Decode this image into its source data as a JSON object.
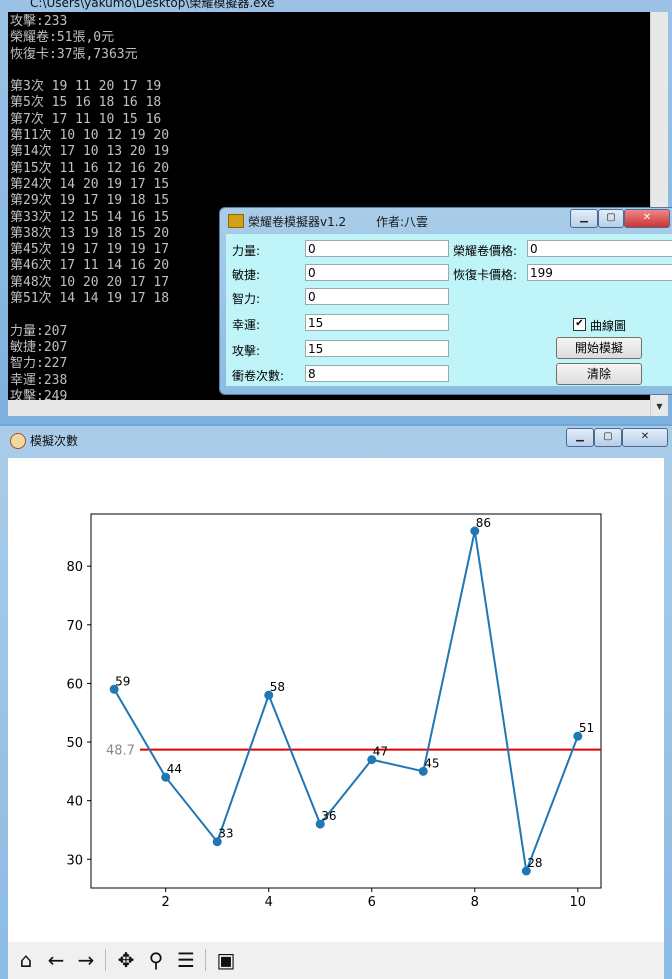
{
  "console": {
    "title": "C:\\Users\\yakumo\\Desktop\\榮耀模擬器.exe",
    "lines": [
      "攻擊:233",
      "榮耀卷:51張,0元",
      "恢復卡:37張,7363元",
      "",
      "第3次 19 11 20 17 19",
      "第5次 15 16 18 16 18",
      "第7次 17 11 10 15 16",
      "第11次 10 10 12 19 20",
      "第14次 17 10 13 20 19",
      "第15次 11 16 12 16 20",
      "第24次 14 20 19 17 15",
      "第29次 19 17 19 18 15",
      "第33次 12 15 14 16 15",
      "第38次 13 19 18 15 20",
      "第45次 19 17 19 19 17",
      "第46次 17 11 14 16 20",
      "第48次 10 20 20 17 17",
      "第51次 14 14 19 17 18",
      "",
      "力量:207",
      "敏捷:207",
      "智力:227",
      "幸運:238",
      "攻擊:249"
    ]
  },
  "simulator": {
    "title": "榮耀卷模擬器v1.2",
    "author": "作者:八雲",
    "fields": {
      "strength_label": "力量:",
      "strength_value": "0",
      "agility_label": "敏捷:",
      "agility_value": "0",
      "intelligence_label": "智力:",
      "intelligence_value": "0",
      "luck_label": "幸運:",
      "luck_value": "15",
      "attack_label": "攻擊:",
      "attack_value": "15",
      "scroll_count_label": "衝卷次數:",
      "scroll_count_value": "8",
      "scroll_price_label": "榮耀卷價格:",
      "scroll_price_value": "0",
      "recovery_price_label": "恢復卡價格:",
      "recovery_price_value": "199"
    },
    "checkbox_label": "曲線圖",
    "checkbox_checked": true,
    "start_button": "開始模擬",
    "clear_button": "清除"
  },
  "plot_window": {
    "title": "模擬次數",
    "toolbar": [
      "home-icon",
      "back-icon",
      "forward-icon",
      "pan-icon",
      "zoom-icon",
      "configure-icon",
      "save-icon"
    ]
  },
  "chart_data": {
    "type": "line",
    "x": [
      1,
      2,
      3,
      4,
      5,
      6,
      7,
      8,
      9,
      10
    ],
    "values": [
      59,
      44,
      33,
      58,
      36,
      47,
      45,
      86,
      28,
      51
    ],
    "point_labels": [
      "59",
      "44",
      "33",
      "58",
      "36",
      "47",
      "45",
      "86",
      "28",
      "51"
    ],
    "average": 48.7,
    "average_label": "48.7",
    "xticks": [
      "2",
      "4",
      "6",
      "8",
      "10"
    ],
    "yticks": [
      "30",
      "40",
      "50",
      "60",
      "70",
      "80"
    ],
    "xlim": [
      0.55,
      10.45
    ],
    "ylim": [
      25.1,
      88.9
    ],
    "line_color": "#1f77b4",
    "average_color": "#e00000",
    "grid": false
  }
}
